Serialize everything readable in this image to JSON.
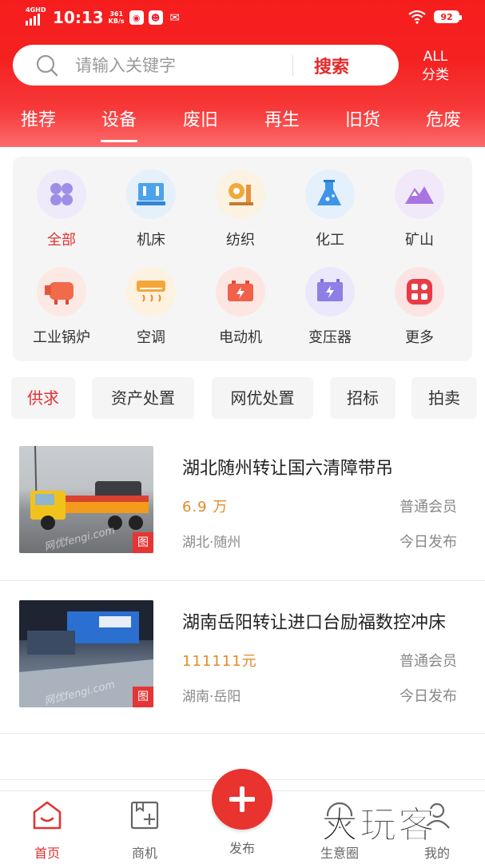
{
  "status_bar": {
    "network": "4GHD",
    "time": "10:13",
    "speed_value": "361",
    "speed_unit": "KB/s",
    "battery": "92"
  },
  "search": {
    "placeholder": "请输入关键字",
    "button_label": "搜索"
  },
  "all_category": {
    "line1": "ALL",
    "line2": "分类"
  },
  "tabs": [
    {
      "label": "推荐"
    },
    {
      "label": "设备",
      "active": true
    },
    {
      "label": "废旧"
    },
    {
      "label": "再生"
    },
    {
      "label": "旧货"
    },
    {
      "label": "危废"
    }
  ],
  "categories": [
    {
      "label": "全部",
      "icon": "grid-four-icon",
      "active": true
    },
    {
      "label": "机床",
      "icon": "machine-tool-icon"
    },
    {
      "label": "纺织",
      "icon": "textile-icon"
    },
    {
      "label": "化工",
      "icon": "flask-icon"
    },
    {
      "label": "矿山",
      "icon": "mountain-icon"
    },
    {
      "label": "工业锅炉",
      "icon": "boiler-icon"
    },
    {
      "label": "空调",
      "icon": "air-conditioner-icon"
    },
    {
      "label": "电动机",
      "icon": "battery-motor-icon"
    },
    {
      "label": "变压器",
      "icon": "transformer-icon"
    },
    {
      "label": "更多",
      "icon": "more-apps-icon"
    }
  ],
  "filter_chips": [
    {
      "label": "供求",
      "active": true
    },
    {
      "label": "资产处置"
    },
    {
      "label": "网优处置"
    },
    {
      "label": "招标"
    },
    {
      "label": "拍卖"
    }
  ],
  "listings": [
    {
      "title": "湖北随州转让国六清障带吊",
      "price": "6.9 万",
      "member": "普通会员",
      "location": "湖北·随州",
      "date": "今日发布",
      "badge": "图",
      "watermark": "网优fengi.com"
    },
    {
      "title": "湖南岳阳转让进口台励福数控冲床",
      "price": "111111元",
      "member": "普通会员",
      "location": "湖南·岳阳",
      "date": "今日发布",
      "badge": "图",
      "watermark": "网优fengi.com"
    }
  ],
  "bottom_nav": {
    "home": "首页",
    "shop": "商机",
    "publish": "发布",
    "circle": "生意圈",
    "mine": "我的"
  },
  "watermark": {
    "text": "大玩客"
  },
  "colors": {
    "brand_red": "#f61d1d",
    "accent_red": "#e23333",
    "price_orange": "#e58a2a"
  }
}
